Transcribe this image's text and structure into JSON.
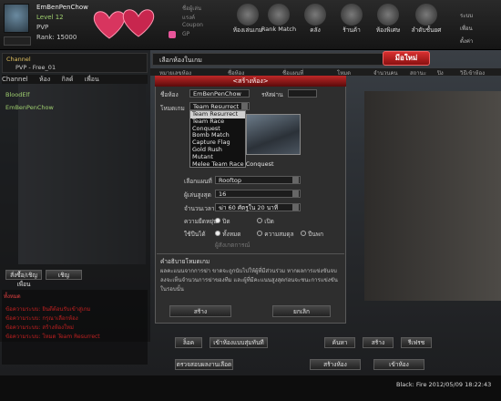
{
  "player": {
    "name": "EmBenPenChow",
    "level": "Level 12",
    "pvp": "PVP",
    "rank": "Rank: 15000"
  },
  "top_stats": [
    "ชื่อผู้เล่น",
    "แรงค์",
    "Coupon",
    "GP"
  ],
  "nav": [
    {
      "label": "ห้องเล่นเกม",
      "icon": "gear-icon"
    },
    {
      "label": "Rank Match",
      "icon": "trophy-icon"
    },
    {
      "label": "คลัง",
      "icon": "inventory-icon"
    },
    {
      "label": "ร้านค้า",
      "icon": "shop-icon"
    },
    {
      "label": "ห้องพิเศษ",
      "icon": "special-icon"
    },
    {
      "label": "ลำดับชั้นยศ",
      "icon": "ranking-icon"
    }
  ],
  "right_links": [
    "ระบบ",
    "เพื่อน",
    "ตั้งค่า"
  ],
  "left_panel": {
    "channel_label": "Channel",
    "server": "PVP - Free_01",
    "tabs": [
      "Channel",
      "ห้อง",
      "กิลด์",
      "เพื่อน"
    ],
    "list_items": [
      "BloodElf",
      "EmBenPenChow"
    ],
    "buttons": [
      "สั่งซื้อ/เชิญเพื่อน",
      "เชิญ"
    ],
    "chat_tab": "ทั้งหมด",
    "chat_lines": [
      "ข้อความระบบ: ยินดีต้อนรับเข้าสู่เกม",
      "ข้อความระบบ: กรุณาเลือกห้อง",
      "ข้อความระบบ: สร้างห้องใหม่",
      "ข้อความระบบ: โหมด Team Resurrect"
    ]
  },
  "lobby": {
    "title": "เลือกห้องในเกม",
    "new_room": "มีอใหม่",
    "columns": [
      "หมายเลขห้อง",
      "ชื่อห้อง",
      "ชื่อแผนที่",
      "โหมด",
      "จำนวนคน",
      "สถานะ",
      "ปิง",
      "วิธีเข้าห้อง"
    ]
  },
  "dialog": {
    "title": "<สร้างห้อง>",
    "room_name_label": "ชื่อห้อง",
    "room_name_value": "EmBenPenChow",
    "password_label": "รหัสผ่าน",
    "mode_label": "โหมดเกม",
    "mode_value": "Team Resurrect",
    "mode_options": [
      "Team Resurrect",
      "Team Race",
      "Conquest",
      "Bomb Match",
      "Capture Flag",
      "Gold Rush",
      "Mutant",
      "Melee Team Race Conquest"
    ],
    "map_label": "เลือกแผนที่",
    "map_value": "Rooftop",
    "max_players_label": "ผู้เล่นสูงสุด",
    "max_players_value": "16",
    "time_label": "จำนวนเวลา",
    "time_value": "ฆ่า 60 ศัตรูใน 20 นาที",
    "difficulty_label": "ความยืดหยุ่น",
    "difficulty_options": [
      "ปิด",
      "เปิด"
    ],
    "weapon_label": "ใช้ปืนได้",
    "weapon_options": [
      "ทั้งหมด",
      "ความสมดุล",
      "ปืนพก"
    ],
    "observer_label": "ผู้สังเกตการณ์",
    "desc_title": "คำอธิบายโหมดเกม",
    "desc_text": "ผลคะแนนจากการฆ่า ขาดจะถูกนับไปให้ผู้ที่มีส่วนร่วม หากผลการแข่งขันจบลงจะเห็นจำนวนการฆ่าของทีม และผู้ที่มีคะแนนสูงสุดก่อนจะชนะการแข่งขันในรอบนั้น",
    "create_button": "สร้าง",
    "cancel_button": "ยกเลิก"
  },
  "bottom": {
    "buttons_row1": [
      "ล็อค",
      "เข้าห้องแบบสุ่มทันที",
      "ค้นหา",
      "สร้าง",
      "รีเฟรช"
    ],
    "buttons_row2": [
      "ตรวจสอบผลงานเลือด",
      "สร้างห้อง",
      "เข้าห้อง"
    ]
  },
  "status": {
    "server_label": "Black: Fire",
    "date": "2012/05/09",
    "time": "18:22:43"
  }
}
